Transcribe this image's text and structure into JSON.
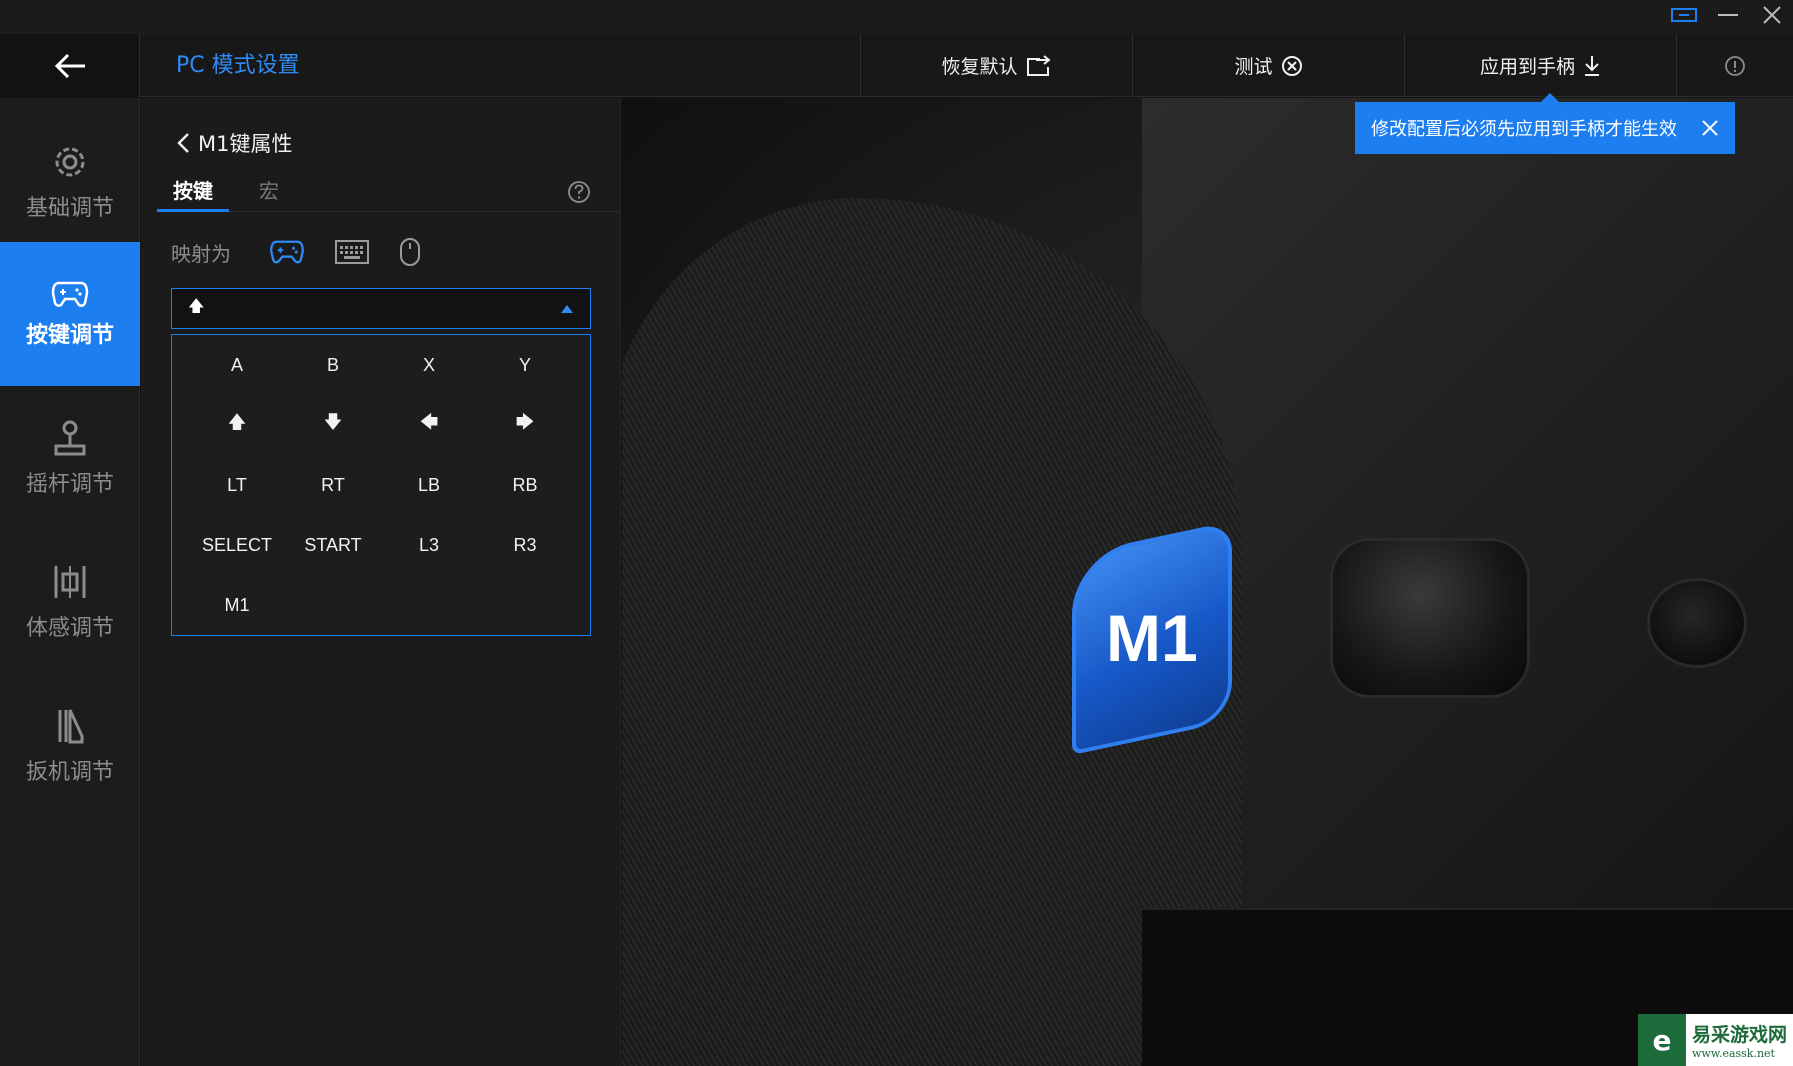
{
  "header": {
    "title": "PC 模式设置",
    "restore_label": "恢复默认",
    "test_label": "测试",
    "apply_label": "应用到手柄"
  },
  "sidebar": {
    "items": [
      {
        "label": "基础调节",
        "icon": "gear-icon"
      },
      {
        "label": "按键调节",
        "icon": "gamepad-icon",
        "active": true
      },
      {
        "label": "摇杆调节",
        "icon": "joystick-icon"
      },
      {
        "label": "体感调节",
        "icon": "motion-icon"
      },
      {
        "label": "扳机调节",
        "icon": "trigger-icon"
      }
    ]
  },
  "panel": {
    "breadcrumb": "M1键属性",
    "tabs": [
      {
        "label": "按键",
        "active": true
      },
      {
        "label": "宏",
        "active": false
      }
    ],
    "map_label": "映射为",
    "selected_value": "🡅",
    "options": [
      "A",
      "B",
      "X",
      "Y",
      "🡅",
      "🡇",
      "🡄",
      "🡆",
      "LT",
      "RT",
      "LB",
      "RB",
      "SELECT",
      "START",
      "L3",
      "R3",
      "M1"
    ]
  },
  "stage": {
    "badge": "M1"
  },
  "toast": {
    "text": "修改配置后必须先应用到手柄才能生效"
  },
  "watermark": {
    "logo": "e",
    "name": "易采游戏网",
    "url": "www.eassk.net"
  },
  "colors": {
    "accent": "#1d7ef0",
    "title_blue": "#2e8bf5",
    "background": "#141414"
  }
}
